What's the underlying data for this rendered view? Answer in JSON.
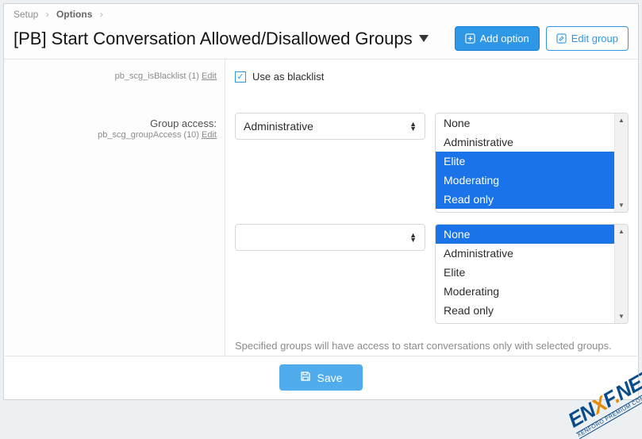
{
  "breadcrumb": {
    "item1": "Setup",
    "item2": "Options"
  },
  "title": "[PB] Start Conversation Allowed/Disallowed Groups",
  "buttons": {
    "add_option": "Add option",
    "edit_group": "Edit group",
    "save": "Save"
  },
  "opt_blacklist": {
    "label": "Use as blacklist",
    "meta": "pb_scg_isBlacklist (1)",
    "edit": "Edit"
  },
  "opt_group": {
    "label": "Group access:",
    "meta": "pb_scg_groupAccess (10)",
    "edit": "Edit"
  },
  "row1": {
    "selected_single": "Administrative",
    "options": [
      {
        "label": "None",
        "selected": false
      },
      {
        "label": "Administrative",
        "selected": false
      },
      {
        "label": "Elite",
        "selected": true
      },
      {
        "label": "Moderating",
        "selected": true
      },
      {
        "label": "Read only",
        "selected": true
      }
    ]
  },
  "row2": {
    "selected_single": "",
    "options": [
      {
        "label": "None",
        "selected": true
      },
      {
        "label": "Administrative",
        "selected": false
      },
      {
        "label": "Elite",
        "selected": false
      },
      {
        "label": "Moderating",
        "selected": false
      },
      {
        "label": "Read only",
        "selected": false
      }
    ]
  },
  "help_text": "Specified groups will have access to start conversations only with selected groups.",
  "watermark": {
    "text": "ENXF.NET",
    "sub": "XENFORO PREMIUM COMMUNITY"
  }
}
